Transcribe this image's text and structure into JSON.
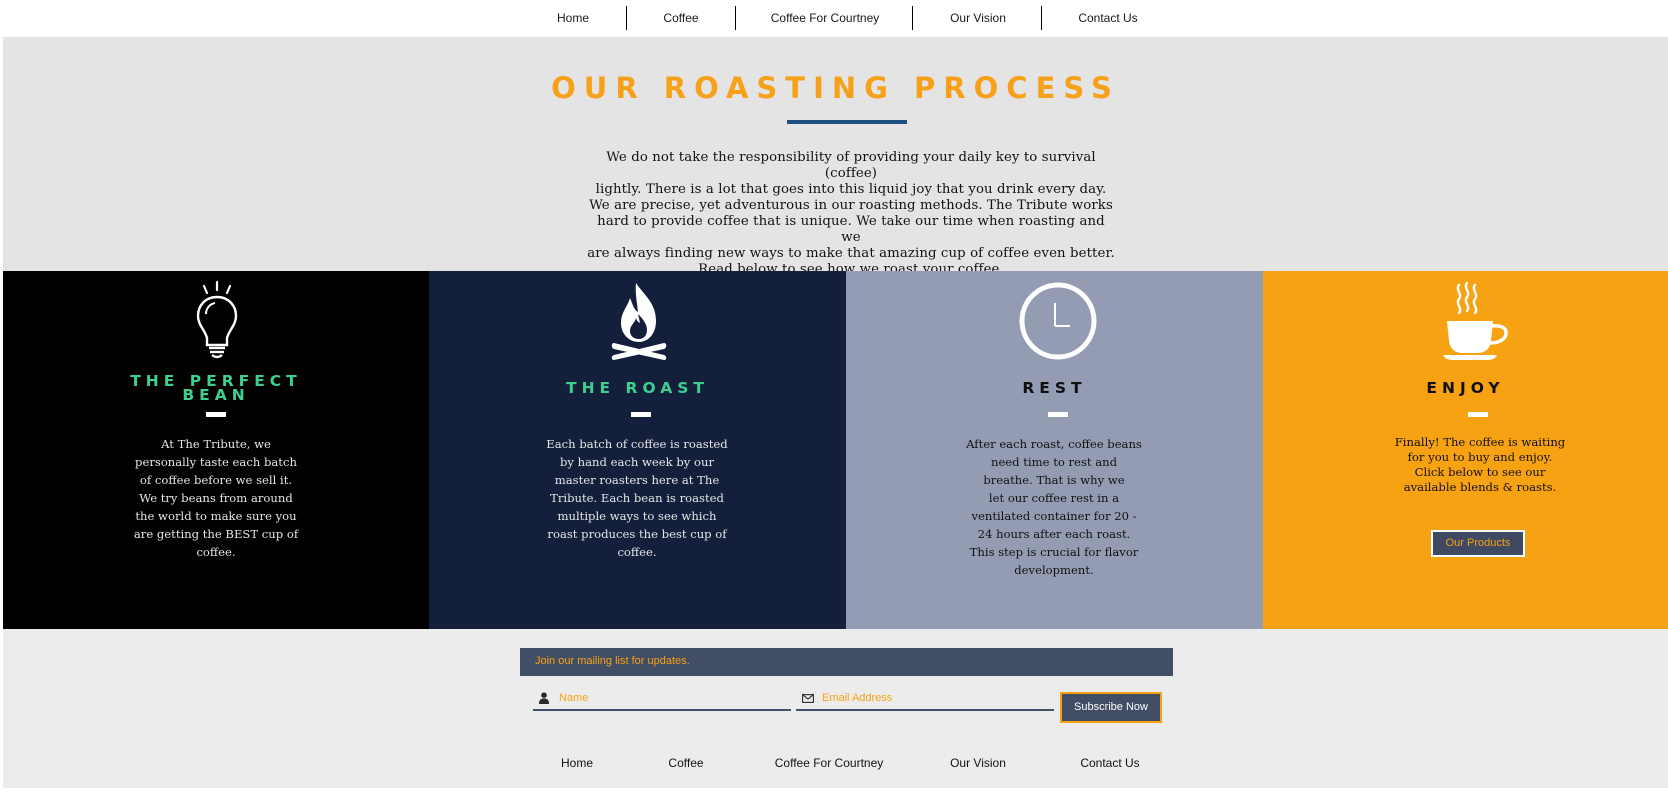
{
  "nav": {
    "items": [
      "Home",
      "Coffee",
      "Coffee For Courtney",
      "Our Vision",
      "Contact Us"
    ]
  },
  "hero": {
    "title": "OUR ROASTING PROCESS",
    "lines": [
      "We do not take the responsibility of providing your daily key to survival (coffee)",
      "lightly. There is a lot that goes into this liquid joy that you drink every day.",
      "We are precise, yet adventurous in our roasting methods. The Tribute works",
      "hard to provide coffee that is unique. We take our time when roasting and we",
      "are always finding new ways to make that amazing cup of coffee even better.",
      "Read below to see how we roast your coffee."
    ]
  },
  "panels": [
    {
      "icon": "lightbulb-icon",
      "title_lines": [
        "THE PERFECT",
        "BEAN"
      ],
      "title_color": "#3ecf8e",
      "text_color": "#e6e6e6",
      "lines": [
        "At The Tribute, we",
        "personally taste each batch",
        "of coffee before we sell it.",
        "We try beans from around",
        "the world to make sure you",
        "are getting the BEST cup of",
        "coffee."
      ]
    },
    {
      "icon": "campfire-icon",
      "title_lines": [
        "THE ROAST"
      ],
      "title_color": "#3ecf8e",
      "text_color": "#e6e6e6",
      "lines": [
        "Each batch of coffee is roasted",
        "by hand each week by our",
        "master roasters here at The",
        "Tribute. Each bean is roasted",
        "multiple ways to see which",
        "roast produces the best cup of",
        "coffee."
      ]
    },
    {
      "icon": "clock-icon",
      "title_lines": [
        "REST"
      ],
      "title_color": "#0f0f0f",
      "text_color": "#111111",
      "lines": [
        "After each roast, coffee beans",
        "need time to rest and",
        "breathe. That is why we",
        "let our coffee rest in a",
        "ventilated container for 20 -",
        "24 hours after each roast.",
        "This step is crucial for flavor",
        "development."
      ]
    },
    {
      "icon": "coffee-cup-icon",
      "title_lines": [
        "ENJOY"
      ],
      "title_color": "#0f0f0f",
      "text_color": "#111111",
      "lines": [
        "Finally! The coffee is waiting",
        "for you to buy and enjoy.",
        "Click below to see our",
        "available blends & roasts."
      ],
      "button_label": "Our Products"
    }
  ],
  "mailing": {
    "banner": "Join our mailing list for updates.",
    "name_placeholder": "Name",
    "email_placeholder": "Email Address",
    "subscribe_label": "Subscribe Now",
    "name_icon": "user-icon",
    "email_icon": "envelope-icon"
  },
  "footer_nav": {
    "items": [
      "Home",
      "Coffee",
      "Coffee For Courtney",
      "Our Vision",
      "Contact Us"
    ]
  },
  "colors": {
    "accent_orange": "#f7a11a",
    "navy": "#141f3c",
    "slate": "#939cb2",
    "teal": "#3ecf8e",
    "rule_blue": "#1d4e80"
  }
}
